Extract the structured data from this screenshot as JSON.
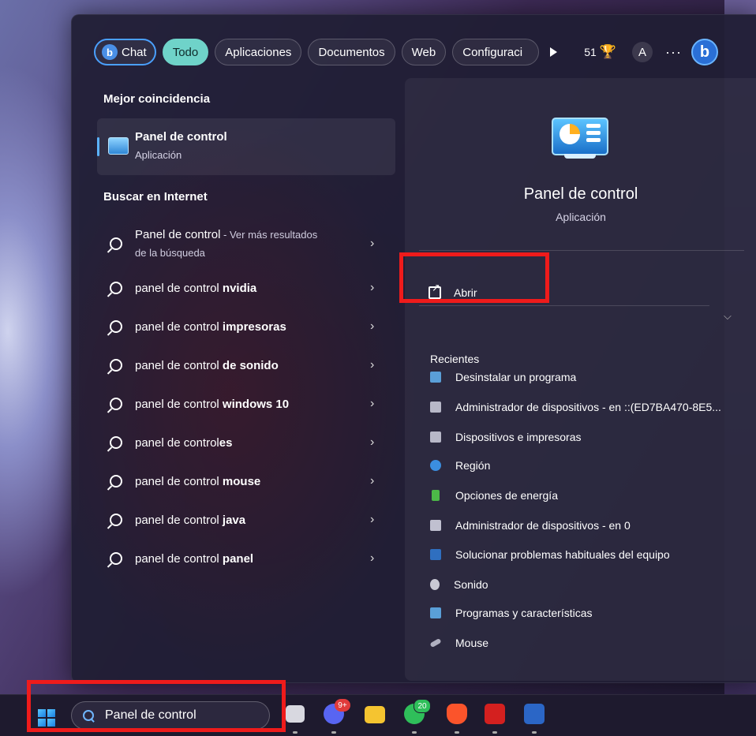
{
  "filters": {
    "chat": "Chat",
    "todo": "Todo",
    "aplicaciones": "Aplicaciones",
    "documentos": "Documentos",
    "web": "Web",
    "configuracion": "Configuraci",
    "points": "51",
    "avatar": "A",
    "more": "···",
    "bing_letter": "b"
  },
  "best_match": {
    "heading": "Mejor coincidencia",
    "name": "Panel de control",
    "type": "Aplicación"
  },
  "web_search": {
    "heading": "Buscar en Internet",
    "first": {
      "bold": "Panel de control",
      "suffix": " - Ver más resultados",
      "line2": "de la búsqueda"
    },
    "items": [
      {
        "plain": "panel de control ",
        "bold": "nvidia"
      },
      {
        "plain": "panel de control ",
        "bold": "impresoras"
      },
      {
        "plain": "panel de control ",
        "bold": "de sonido"
      },
      {
        "plain": "panel de control ",
        "bold": "windows 10"
      },
      {
        "plain": "panel de control",
        "bold": "es"
      },
      {
        "plain": "panel de control ",
        "bold": "mouse"
      },
      {
        "plain": "panel de control ",
        "bold": "java"
      },
      {
        "plain": "panel de control ",
        "bold": "panel"
      }
    ]
  },
  "preview": {
    "title": "Panel de control",
    "subtitle": "Aplicación",
    "open_label": "Abrir",
    "recent_heading": "Recientes",
    "recent": [
      "Desinstalar un programa",
      "Administrador de dispositivos - en ::(ED7BA470-8E5...",
      "Dispositivos e impresoras",
      "Región",
      "Opciones de energía",
      "Administrador de dispositivos - en 0",
      "Solucionar problemas habituales del equipo",
      "Sonido",
      "Programas y características",
      "Mouse"
    ]
  },
  "taskbar": {
    "search_value": "Panel de control",
    "discord_badge": "9+",
    "whatsapp_badge": "20"
  },
  "colors": {
    "highlight": "#ef1b1b",
    "active_filter": "#6fd3c9",
    "bing_blue": "#2a6fd6"
  }
}
